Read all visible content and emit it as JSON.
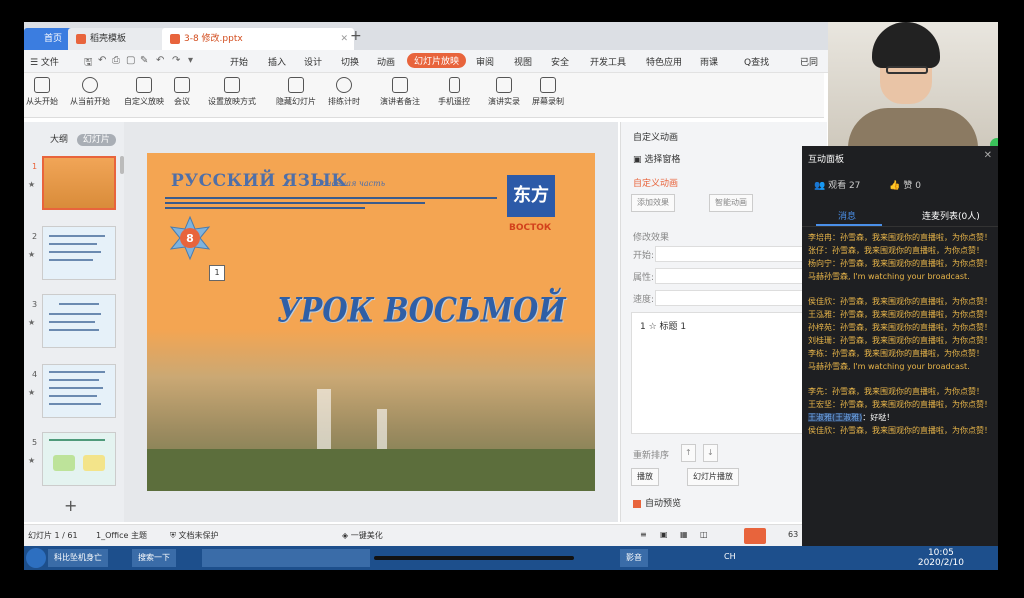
{
  "tabs": {
    "home": "首页",
    "template": "稻壳模板",
    "document": "3-8 修改.pptx",
    "add": "+"
  },
  "menu": {
    "file": "☰ 文件",
    "items": [
      "开始",
      "插入",
      "设计",
      "切换",
      "动画",
      "幻灯片放映",
      "审阅",
      "视图",
      "安全",
      "开发工具",
      "特色应用",
      "雨课",
      "Q查找"
    ],
    "share": "已同"
  },
  "ribbon": {
    "buttons": [
      "从头开始",
      "从当前开始",
      "自定义放映",
      "会议",
      "设置放映方式",
      "隐藏幻灯片",
      "排练计时",
      "演讲者备注",
      "手机遥控",
      "演讲实录",
      "屏幕录制"
    ]
  },
  "slide_panel": {
    "outline_tab": "大纲",
    "slides_tab": "幻灯片",
    "thumb_numbers": [
      "1",
      "2",
      "3",
      "4",
      "5"
    ]
  },
  "slide": {
    "title": "РУССКИЙ ЯЗЫК",
    "subtitle": "основная часть",
    "publisher": "ВОСТОК",
    "logo_text": "东方",
    "badge": "8",
    "anim_marker": "1",
    "heading": "УРОК ВОСЬМОЙ"
  },
  "anim_panel": {
    "header": "自定义动画",
    "selection_pane": "选择窗格",
    "custom_anim": "自定义动画",
    "add_effect": "添加效果",
    "smart_anim": "智能动画",
    "modify_effect": "修改效果",
    "start_label": "开始:",
    "property_label": "属性:",
    "speed_label": "速度:",
    "list_item": "1  ☆  标题 1",
    "reorder": "重新排序",
    "play": "播放",
    "slideshow": "幻灯片播放",
    "auto_preview": "自动预览"
  },
  "status": {
    "slide_count": "幻灯片 1 / 61",
    "theme": "1_Office 主题",
    "protect": "文档未保护",
    "beautify": "一键美化",
    "zoom": "63"
  },
  "taskbar": {
    "item1": "科比坠机身亡",
    "item2": "搜索一下",
    "item3": "影音",
    "ime": "CH",
    "time": "10:05",
    "date": "2020/2/10"
  },
  "live": {
    "panel_title": "互动面板",
    "viewers": "观看 27",
    "likes": "赞 0",
    "tab_messages": "消息",
    "tab_mic": "连麦列表(0人)",
    "messages": [
      {
        "name": "李培冉",
        "text": "：孙雪森，我来围观你的直播啦，为你点赞！"
      },
      {
        "name": "张仔",
        "text": "：孙雪森，我来围观你的直播啦，为你点赞！"
      },
      {
        "name": "杨向宁",
        "text": "：孙雪森，我来围观你的直播啦，为你点赞！"
      },
      {
        "name": "马赫孙雪森",
        "text": ", I'm watching your broadcast."
      },
      {
        "name": "侯佳欣",
        "text": "：孙雪森，我来围观你的直播啦，为你点赞！"
      },
      {
        "name": "王泓雅",
        "text": "：孙雪森，我来围观你的直播啦，为你点赞！"
      },
      {
        "name": "孙梓苑",
        "text": "：孙雪森，我来围观你的直播啦，为你点赞！"
      },
      {
        "name": "刘桂珊",
        "text": "：孙雪森，我来围观你的直播啦，为你点赞！"
      },
      {
        "name": "李栋",
        "text": "：孙雪森，我来围观你的直播啦，为你点赞！"
      },
      {
        "name": "马赫孙雪森",
        "text": ", I'm watching your broadcast."
      },
      {
        "name": "李先",
        "text": "：孙雪森，我来围观你的直播啦，为你点赞！"
      },
      {
        "name": "王宏坚",
        "text": "：孙雪森，我来围观你的直播啦，为你点赞！"
      },
      {
        "name": "王淑雅(王淑雅)",
        "text": "：好哒！",
        "highlight": true
      },
      {
        "name": "侯佳欣",
        "text": "：孙雪森，我来围观你的直播啦，为你点赞！"
      }
    ]
  }
}
